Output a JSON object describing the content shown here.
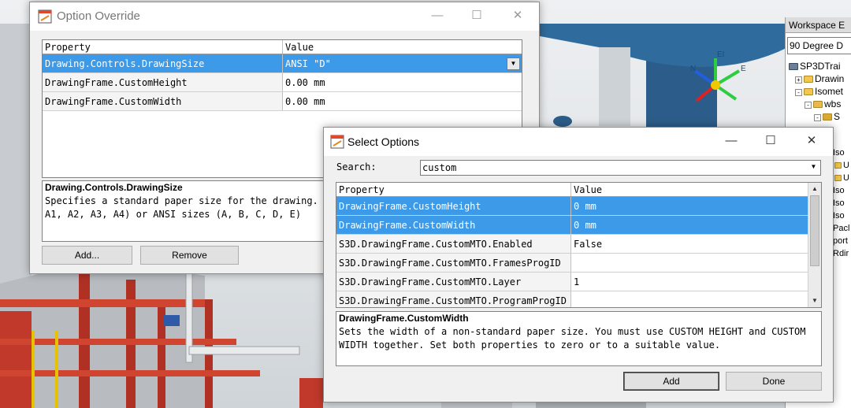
{
  "workspace": {
    "header": "Workspace E",
    "selector_value": "90 Degree D",
    "tree": [
      {
        "label": "SP3DTrai",
        "icon": "workspace-icon",
        "expander": "-"
      },
      {
        "label": "Drawin",
        "icon": "folder-icon",
        "expander": "+"
      },
      {
        "label": "Isomet",
        "icon": "folder-icon",
        "expander": "-"
      },
      {
        "label": "wbs",
        "icon": "wbs-icon",
        "expander": "-"
      },
      {
        "label": "S",
        "icon": "gear-folder-icon",
        "expander": "-"
      }
    ],
    "side_items": [
      "Iso",
      "U",
      "U",
      "Iso",
      "Iso",
      "Iso",
      "Pacl",
      "port",
      "Rdir"
    ]
  },
  "scene": {
    "axis_labels": [
      "EI",
      "N",
      "E"
    ]
  },
  "option_override": {
    "title": "Option Override",
    "columns": [
      "Property",
      "Value"
    ],
    "rows": [
      {
        "property": "Drawing.Controls.DrawingSize",
        "value": "ANSI \"D\"",
        "selected": true
      },
      {
        "property": "DrawingFrame.CustomHeight",
        "value": "0.00 mm",
        "selected": false
      },
      {
        "property": "DrawingFrame.CustomWidth",
        "value": "0.00 mm",
        "selected": false
      }
    ],
    "description_title": "Drawing.Controls.DrawingSize",
    "description_text": "Specifies a standard paper size for the drawing. Y\nA1, A2, A3, A4) or ANSI sizes (A, B, C, D, E)",
    "add_button": "Add...",
    "remove_button": "Remove"
  },
  "select_options": {
    "title": "Select Options",
    "search_label": "Search:",
    "search_value": "custom",
    "columns": [
      "Property",
      "Value"
    ],
    "rows": [
      {
        "property": "DrawingFrame.CustomHeight",
        "value": "0 mm",
        "selected": true
      },
      {
        "property": "DrawingFrame.CustomWidth",
        "value": "0 mm",
        "selected": true
      },
      {
        "property": "S3D.DrawingFrame.CustomMTO.Enabled",
        "value": "False",
        "selected": false
      },
      {
        "property": "S3D.DrawingFrame.CustomMTO.FramesProgID",
        "value": "",
        "selected": false
      },
      {
        "property": "S3D.DrawingFrame.CustomMTO.Layer",
        "value": "1",
        "selected": false
      },
      {
        "property": "S3D.DrawingFrame.CustomMTO.ProgramProgID",
        "value": "",
        "selected": false
      }
    ],
    "description_title": "DrawingFrame.CustomWidth",
    "description_text": "Sets the width of a non-standard paper size. You must use CUSTOM HEIGHT and CUSTOM\nWIDTH together. Set both properties to zero or to a suitable value.",
    "add_button": "Add",
    "done_button": "Done"
  },
  "window_controls": {
    "minimize": "—",
    "maximize": "☐",
    "close": "✕"
  },
  "colors": {
    "selection": "#3d9ae8",
    "pipe_red": "#c0392b",
    "tank_blue": "#2c5d8a"
  }
}
